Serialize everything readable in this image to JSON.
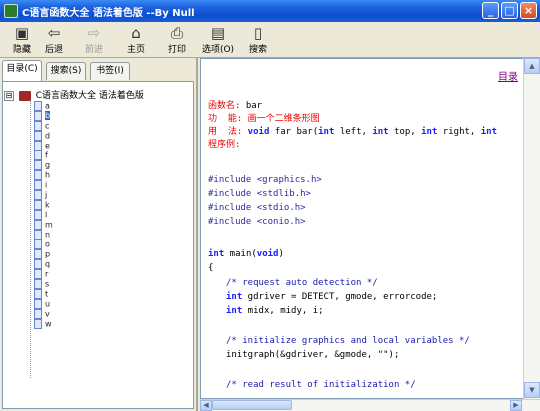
{
  "window": {
    "title": "C语言函数大全 语法着色版 --By Null"
  },
  "toolbar": {
    "items": [
      {
        "label": "隐藏",
        "icon": "hide-icon",
        "glyph": "▣"
      },
      {
        "label": "后退",
        "icon": "back-arrow-icon",
        "glyph": "⇦"
      },
      {
        "label": "前进",
        "icon": "forward-arrow-icon",
        "glyph": "⇨"
      },
      {
        "label": "主页",
        "icon": "home-icon",
        "glyph": "⌂"
      },
      {
        "label": "打印",
        "icon": "print-icon",
        "glyph": "⎙"
      },
      {
        "label": "选项(O)",
        "icon": "options-icon",
        "glyph": "▤"
      },
      {
        "label": "搜索",
        "icon": "search-icon",
        "glyph": "▯"
      }
    ]
  },
  "tabs": [
    {
      "label": "目录(C)"
    },
    {
      "label": "搜索(S)"
    },
    {
      "label": "书签(I)"
    }
  ],
  "tree": {
    "root_expander": "⊟",
    "root_label": "C语言函数大全 语法着色版",
    "items": [
      "a",
      "b",
      "c",
      "d",
      "e",
      "f",
      "g",
      "h",
      "i",
      "j",
      "k",
      "l",
      "m",
      "n",
      "o",
      "p",
      "q",
      "r",
      "s",
      "t",
      "u",
      "v",
      "w"
    ],
    "selected_index": 1
  },
  "content": {
    "toc_link": "目录",
    "func_name_label": "函数名:",
    "func_name_value": " bar",
    "func_label": "功  能:",
    "func_value": " 画一个二维条形图",
    "usage_label": "用  法:",
    "usage_kw1": " void",
    "usage_mid1": " far bar(",
    "usage_kw2": "int",
    "usage_mid2": " left, ",
    "usage_kw3": "int",
    "usage_mid3": " top, ",
    "usage_kw4": "int",
    "usage_mid4": " right, ",
    "usage_kw5": "int",
    "example_label": "程序例:",
    "include1": "#include <graphics.h>",
    "include2": "#include <stdlib.h>",
    "include3": "#include <stdio.h>",
    "include4": "#include <conio.h>",
    "main_kw1": "int",
    "main_rest": " main(",
    "main_kw2": "void",
    "main_close": ")",
    "brace": "{",
    "comment1": "/* request auto detection */",
    "gd_kw": "int",
    "gd_rest": " gdriver = DETECT, gmode, errorcode;",
    "mid_kw": "int",
    "mid_rest": " midx, midy, i;",
    "comment2": "/* initialize graphics and local variables */",
    "initgraph": "initgraph(&gdriver, &gmode, \"\");",
    "comment3": "/* read result of initialization */"
  },
  "scroll": {
    "up": "▲",
    "down": "▼",
    "left": "◀",
    "right": "▶"
  }
}
